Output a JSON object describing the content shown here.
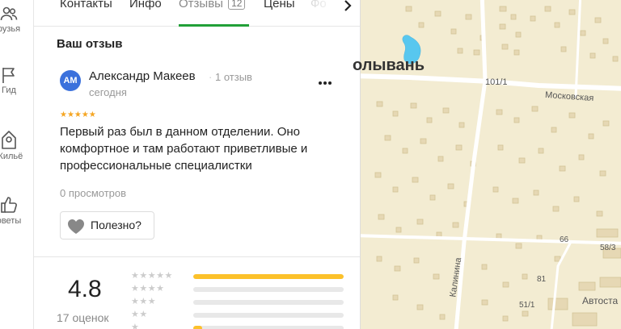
{
  "rail": {
    "items": [
      {
        "label": "рузья",
        "icon": "friends-icon"
      },
      {
        "label": "Гид",
        "icon": "flag-icon"
      },
      {
        "label": "Жильё",
        "icon": "home-icon"
      },
      {
        "label": "оветы",
        "icon": "thumbs-up-icon"
      }
    ]
  },
  "tabs": {
    "items": [
      {
        "label": "Контакты"
      },
      {
        "label": "Инфо"
      },
      {
        "label": "Отзывы",
        "count": "12"
      },
      {
        "label": "Цены"
      },
      {
        "label": "Фо"
      }
    ],
    "active": "Отзывы",
    "accent": "#21a038",
    "next_icon": "chevron-right-icon"
  },
  "review": {
    "section_title": "Ваш отзыв",
    "avatar_initials": "АМ",
    "avatar_color": "#3b71dc",
    "author": "Александр Макеев",
    "separator": "·",
    "author_reviews": "1 отзыв",
    "date": "сегодня",
    "stars": "★★★★★",
    "star_color": "#f5a623",
    "text": "Первый раз был в данном отделении. Оно комфортное и там работают приветливые и профессиональные специалистки",
    "views": "0 просмотров",
    "useful_label": "Полезно?",
    "useful_icon": "heart-icon",
    "more_icon": "more-dots-icon"
  },
  "summary": {
    "rating": "4.8",
    "count_label": "17 оценок",
    "bar_color": "#fcc12a",
    "distribution": [
      {
        "stars": "★★★★★",
        "fraction": 1.0
      },
      {
        "stars": "★★★★",
        "fraction": 0.0
      },
      {
        "stars": "★★★",
        "fraction": 0.0
      },
      {
        "stars": "★★",
        "fraction": 0.0
      },
      {
        "stars": "★",
        "fraction": 0.06
      }
    ]
  },
  "map": {
    "labels": {
      "town": "олывань",
      "street_moskovskaya": "Московская",
      "street_kalinina": "Калинина",
      "house_101_1": "101/1",
      "house_66": "66",
      "house_58_3": "58/3",
      "house_81": "81",
      "house_51_1": "51/1",
      "poi_avtost": "Автоста"
    },
    "colors": {
      "land": "#f3ecd2",
      "road": "#ffffff",
      "water": "#58c7ef",
      "buildings": "#e6d8b4"
    }
  }
}
